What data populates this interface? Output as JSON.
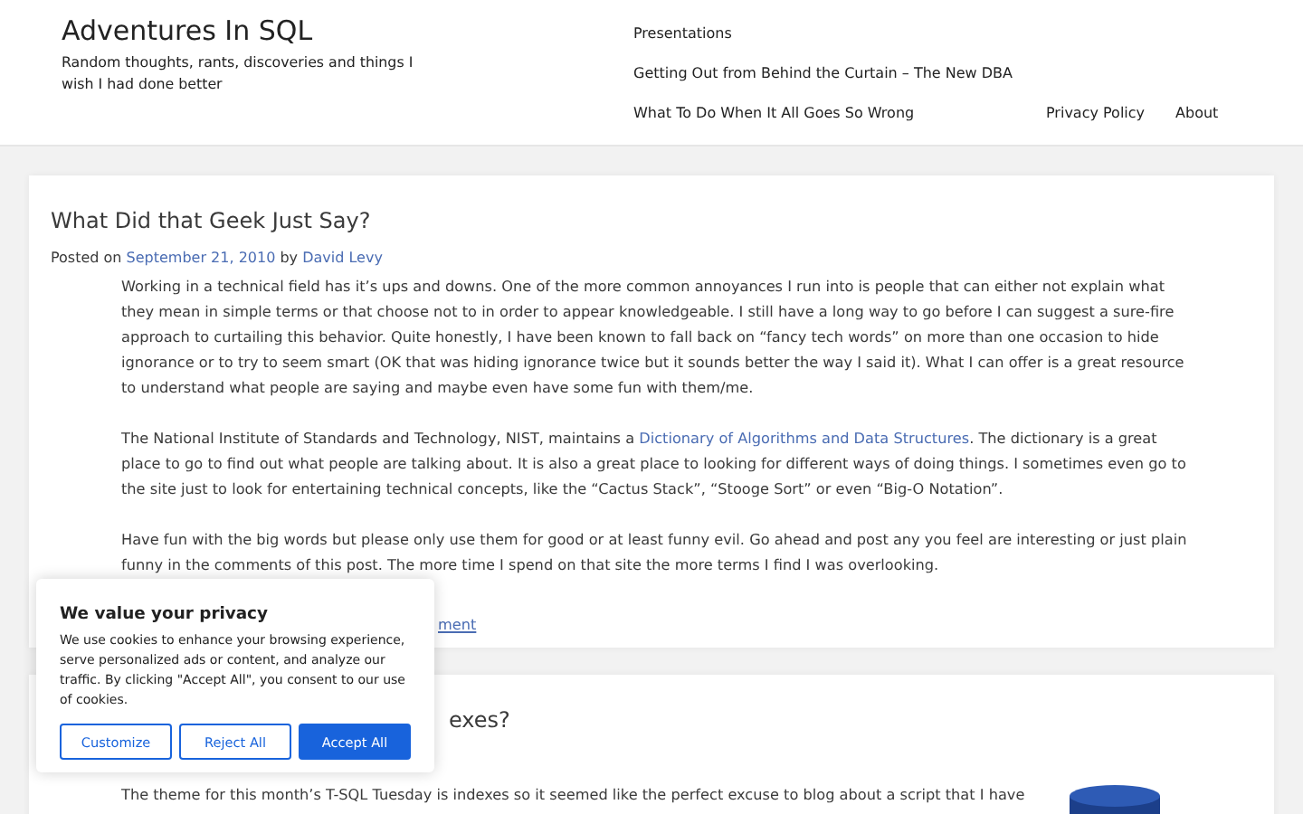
{
  "header": {
    "site_title": "Adventures In SQL",
    "tagline": "Random thoughts, rants, discoveries and things I wish I had done better",
    "nav_rows": [
      [
        "Presentations"
      ],
      [
        "Getting Out from Behind the Curtain – The New DBA"
      ],
      [
        "What To Do When It All Goes So Wrong",
        "Privacy Policy",
        "About"
      ]
    ]
  },
  "posts": [
    {
      "title": "What Did that Geek Just Say?",
      "meta": {
        "posted_on": "Posted on",
        "date": "September 21, 2010",
        "by": "by",
        "author": "David Levy"
      },
      "paragraphs": [
        [
          {
            "kind": "text",
            "text": "Working in a technical field has it’s ups and downs. One of the more common annoyances I run into is people that can either not explain what they mean in simple terms or that choose not to in order to appear knowledgeable. I still have a long way to go before I can suggest a sure-fire approach to curtailing this behavior. Quite honestly, I have been known to fall back on “fancy tech words” on more than one occasion to hide ignorance or to try to seem smart (OK that was hiding ignorance twice but it sounds better the way I said it). What I can offer is a great resource to understand what people are saying and maybe even have some fun with them/me."
          }
        ],
        [
          {
            "kind": "text",
            "text": "The National Institute of Standards and Technology, NIST, maintains a "
          },
          {
            "kind": "link",
            "text": "Dictionary of Algorithms and Data Structures"
          },
          {
            "kind": "text",
            "text": ". The dictionary is a great place to go to find out what people are talking about. It is also a great place to looking for different ways of doing things. I sometimes even go to the site just to look for entertaining technical concepts, like the “Cactus Stack”, “Stooge Sort” or even “Big-O Notation”."
          }
        ],
        [
          {
            "kind": "text",
            "text": "Have fun with the big words but please only use them for good or at least funny evil. Go ahead and post any you feel are interesting or just plain funny in the comments of this post. The more time I spend on that site the more terms I find I was overlooking."
          }
        ]
      ],
      "comment_link": "ment"
    },
    {
      "title": "exes?",
      "paragraphs": [
        [
          {
            "kind": "text",
            "text": "The theme for this month’s T-SQL Tuesday is indexes so it seemed like the perfect excuse to blog about a script that I have"
          }
        ]
      ],
      "image": {
        "kind": "picture"
      }
    }
  ],
  "cookie_banner": {
    "title": "We value your privacy",
    "text": "We use cookies to enhance your browsing experience, serve personalized ads or content, and analyze our traffic. By clicking \"Accept All\", you consent to our use of cookies.",
    "buttons": [
      {
        "label": "Customize",
        "primary": false
      },
      {
        "label": "Reject All",
        "primary": false
      },
      {
        "label": "Accept All",
        "primary": true
      }
    ]
  }
}
